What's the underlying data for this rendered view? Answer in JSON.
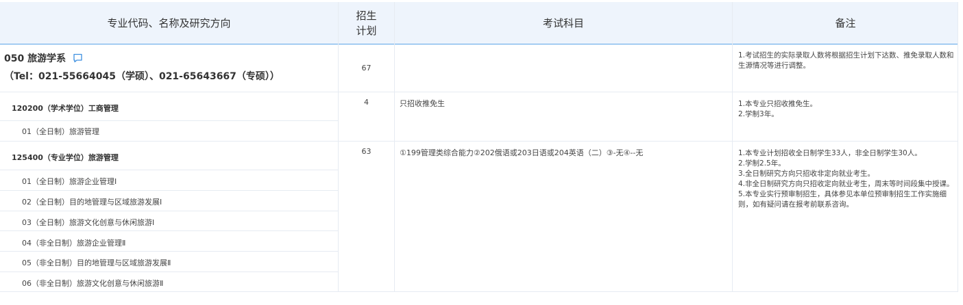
{
  "header": {
    "col1": "专业代码、名称及研究方向",
    "col2_line1": "招生",
    "col2_line2": "计划",
    "col3": "考试科目",
    "col4": "备注"
  },
  "department": {
    "name": "050 旅游学系",
    "tel": "（Tel：021-55664045（学硕）、021-65643667（专硕））",
    "plan": "67",
    "note": "1.考试招生的实际录取人数将根据招生计划下达数、推免录取人数和生源情况等进行调整。",
    "comment_icon": "comment-icon"
  },
  "majors": [
    {
      "title": "120200（学术学位）工商管理",
      "plan": "4",
      "exam": "只招收推免生",
      "notes": [
        "1.本专业只招收推免生。",
        "2.学制3年。"
      ],
      "directions": [
        "01（全日制）旅游管理"
      ]
    },
    {
      "title": "125400（专业学位）旅游管理",
      "plan": "63",
      "exam": "①199管理类综合能力②202俄语或203日语或204英语（二）③-无④--无",
      "notes": [
        "1.本专业计划招收全日制学生33人，非全日制学生30人。",
        "2.学制2.5年。",
        "3.全日制研究方向只招收非定向就业考生。",
        "4.非全日制研究方向只招收定向就业考生，周末等时间段集中授课。",
        "5.本专业实行预审制招生，具体参见本单位预审制招生工作实施细则，如有疑问请在报考前联系咨询。"
      ],
      "directions": [
        "01（全日制）旅游企业管理Ⅰ",
        "02（全日制）目的地管理与区域旅游发展Ⅰ",
        "03（全日制）旅游文化创意与休闲旅游Ⅰ",
        "04（非全日制）旅游企业管理Ⅱ",
        "05（非全日制）目的地管理与区域旅游发展Ⅱ",
        "06（非全日制）旅游文化创意与休闲旅游Ⅱ"
      ]
    }
  ],
  "colors": {
    "header_bg": "#eef4fc",
    "header_border": "#5aa3e8",
    "grid": "#e6ebf2",
    "icon": "#3d8fe0"
  }
}
